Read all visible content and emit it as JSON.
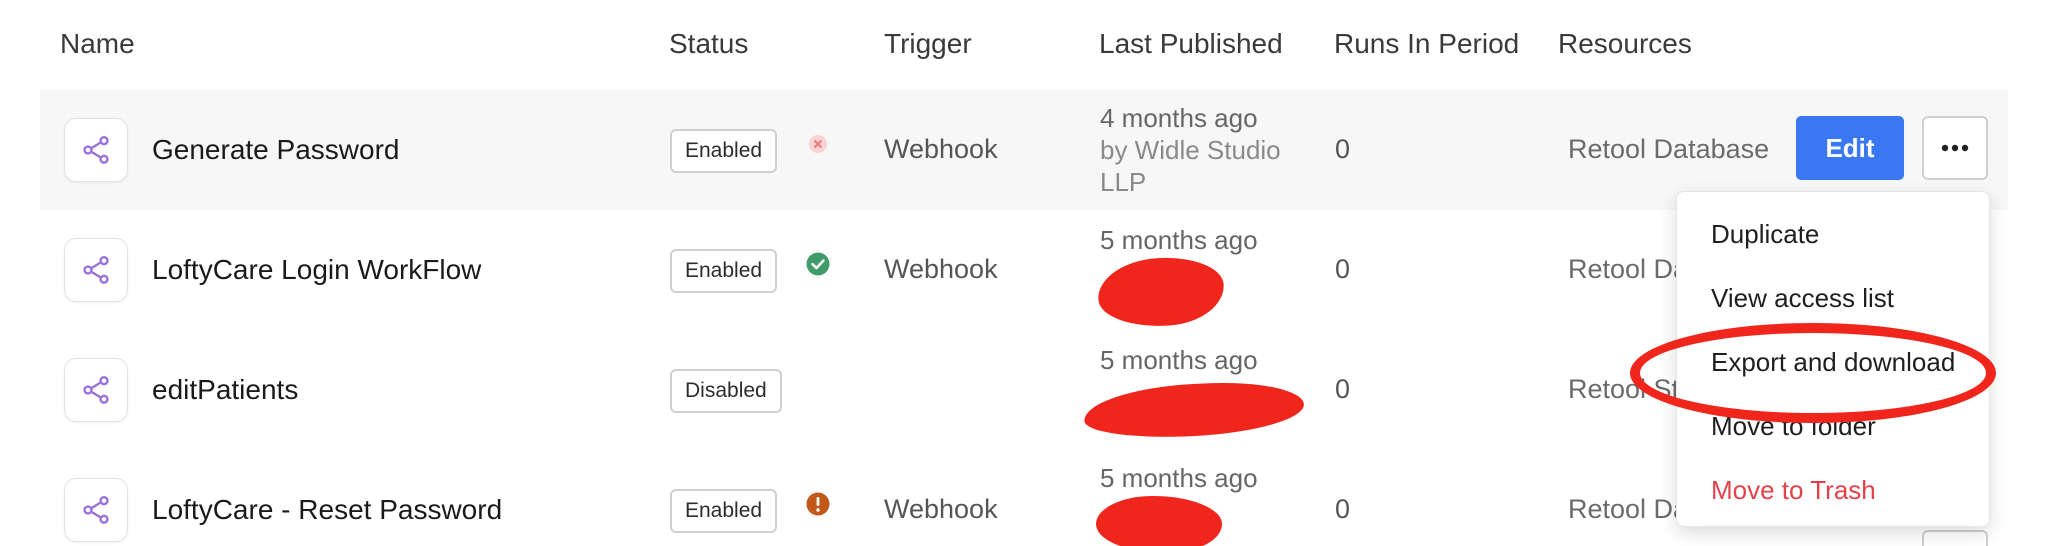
{
  "table": {
    "headers": {
      "name": "Name",
      "status": "Status",
      "trigger": "Trigger",
      "last_published": "Last Published",
      "runs": "Runs In Period",
      "resources": "Resources"
    },
    "rows": [
      {
        "name": "Generate Password",
        "status": "Enabled",
        "status_icon": "error-x-icon",
        "trigger": "Webhook",
        "published_when": "4 months ago",
        "published_by_1": "by Widle Studio",
        "published_by_2": "LLP",
        "runs": "0",
        "resources": "Retool Database"
      },
      {
        "name": "LoftyCare Login WorkFlow",
        "status": "Enabled",
        "status_icon": "success-check-icon",
        "trigger": "Webhook",
        "published_when": "5 months ago",
        "runs": "0",
        "resources": "Retool Da"
      },
      {
        "name": "editPatients",
        "status": "Disabled",
        "trigger": "",
        "published_when": "5 months ago",
        "runs": "0",
        "resources": "Retool St"
      },
      {
        "name": "LoftyCare - Reset Password",
        "status": "Enabled",
        "status_icon": "warning-exclamation-icon",
        "trigger": "Webhook",
        "published_when": "5 months ago",
        "runs": "0",
        "resources": "Retool Da"
      }
    ]
  },
  "actions": {
    "edit_label": "Edit",
    "more_icon": "more-horizontal-icon"
  },
  "menu": {
    "items": [
      "Duplicate",
      "View access list",
      "Export and download",
      "Move to folder"
    ],
    "danger_item": "Move to Trash"
  },
  "colors": {
    "accent": "#3a78f2",
    "workflow_icon": "#9b72d9",
    "status_error": "#f08a8a",
    "status_success": "#3f9c6a",
    "status_warning": "#c2571a",
    "danger": "#e3424a",
    "annotation": "#f0261c"
  }
}
